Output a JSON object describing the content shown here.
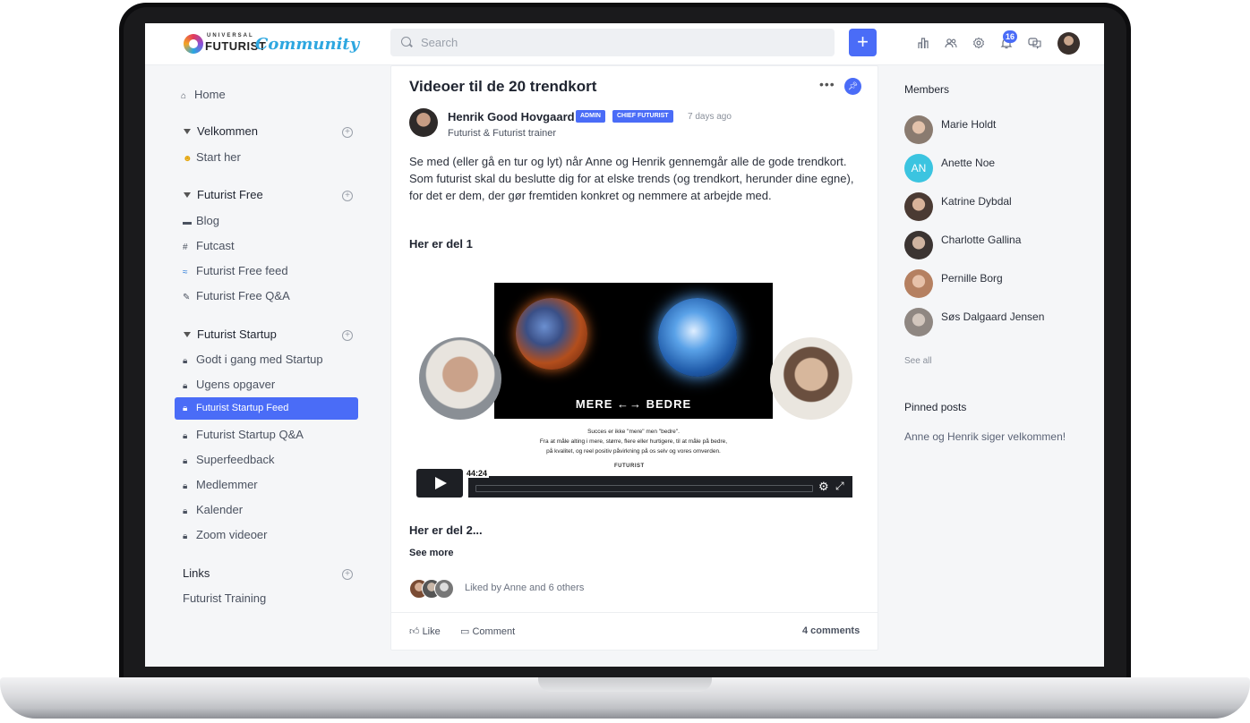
{
  "brand": {
    "small": "UNIVERSAL",
    "main": "FUTURIST",
    "script": "Community"
  },
  "search": {
    "placeholder": "Search"
  },
  "topbar": {
    "add_label": "+",
    "notifications_count": "16"
  },
  "sidebar": {
    "home": "Home",
    "sections": [
      {
        "title": "Velkommen",
        "items": [
          "Start her"
        ]
      },
      {
        "title": "Futurist Free",
        "items": [
          "Blog",
          "Futcast",
          "Futurist Free feed",
          "Futurist Free Q&A"
        ]
      },
      {
        "title": "Futurist Startup",
        "items": [
          "Godt i gang med Startup",
          "Ugens opgaver",
          "Futurist Startup Feed",
          "Futurist Startup Q&A",
          "Superfeedback",
          "Medlemmer",
          "Kalender",
          "Zoom videoer"
        ]
      },
      {
        "title": "Links",
        "items": [
          "Futurist Training"
        ]
      }
    ],
    "icons": [
      "home-icon",
      "smiley-icon",
      "monitor-icon",
      "hash-icon",
      "wave-icon",
      "pencil-icon",
      "lock-icon"
    ]
  },
  "post": {
    "title": "Videoer til de 20 trendkort",
    "author": "Henrik Good Hovgaard",
    "tags": [
      "ADMIN",
      "CHIEF FUTURIST"
    ],
    "time_ago": "7 days ago",
    "subtitle": "Futurist & Futurist trainer",
    "body": "Se med (eller gå en tur og lyt) når Anne og Henrik gennemgår alle de gode trendkort. Som futurist skal du beslutte dig for at elske trends (og trendkort, herunder dine egne), for det er dem, der gør fremtiden konkret og nemmere at arbejde med.",
    "section1": "Her er del 1",
    "section2": "Her er del 2...",
    "see_more": "See more",
    "video": {
      "overlay": "MERE ←→ BEDRE",
      "caption_line1": "Succes er ikke \"mere\" men \"bedre\".",
      "caption_line2": "Fra at måle alting i mere, større, flere eller hurtigere, til at måle på bedre,",
      "caption_line3": "på kvalitet, og reel positiv påvirkning på os selv og vores omverden.",
      "caption_logo": "FUTURIST",
      "duration": "44:24"
    },
    "liked_by": "Liked by Anne and 6 others",
    "actions": {
      "like": "Like",
      "comment": "Comment",
      "comments_count": "4 comments"
    }
  },
  "members": {
    "title": "Members",
    "list": [
      {
        "name": "Marie Holdt",
        "initials": ""
      },
      {
        "name": "Anette Noe",
        "initials": "AN"
      },
      {
        "name": "Katrine Dybdal",
        "initials": ""
      },
      {
        "name": "Charlotte Gallina",
        "initials": ""
      },
      {
        "name": "Pernille Borg",
        "initials": ""
      },
      {
        "name": "Søs Dalgaard Jensen",
        "initials": ""
      }
    ],
    "see_all": "See all"
  },
  "pinned": {
    "title": "Pinned posts",
    "items": [
      "Anne og Henrik siger velkommen!"
    ]
  },
  "colors": {
    "accent": "#4a6cf7",
    "initials_avatar": "#3bc4e0"
  }
}
